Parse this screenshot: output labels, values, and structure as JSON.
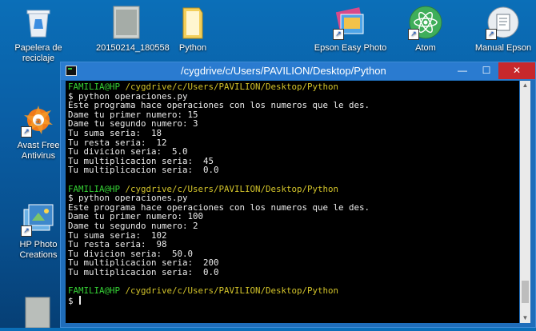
{
  "desktop": {
    "icons": [
      {
        "label": "Papelera de reciclaje",
        "icon": "recycle-bin-icon"
      },
      {
        "label": "20150214_180558",
        "icon": "image-file-icon"
      },
      {
        "label": "Python",
        "icon": "folder-icon"
      },
      {
        "label": "Epson Easy Photo",
        "icon": "photo-app-icon"
      },
      {
        "label": "Atom",
        "icon": "atom-icon"
      },
      {
        "label": "Manual Epson",
        "icon": "manual-icon"
      },
      {
        "label": "Avast Free Antivirus",
        "icon": "avast-icon"
      },
      {
        "label": "HP Photo Creations",
        "icon": "hp-photo-icon"
      }
    ]
  },
  "terminal": {
    "title": "/cygdrive/c/Users/PAVILION/Desktop/Python",
    "controls": {
      "minimize": "—",
      "maximize": "☐",
      "close": "✕"
    },
    "prompt_user": "FAMILIA@HP",
    "prompt_path": "/cygdrive/c/Users/PAVILION/Desktop/Python",
    "session1": [
      "$ python operaciones.py",
      "Este programa hace operaciones con los numeros que le des.",
      "Dame tu primer numero: 15",
      "Dame tu segundo numero: 3",
      "Tu suma seria:  18",
      "Tu resta seria:  12",
      "Tu divicion seria:  5.0",
      "Tu multiplicacion seria:  45",
      "Tu multiplicacion seria:  0.0"
    ],
    "session2": [
      "$ python operaciones.py",
      "Este programa hace operaciones con los numeros que le des.",
      "Dame tu primer numero: 100",
      "Dame tu segundo numero: 2",
      "Tu suma seria:  102",
      "Tu resta seria:  98",
      "Tu divicion seria:  50.0",
      "Tu multiplicacion seria:  200",
      "Tu multiplicacion seria:  0.0"
    ],
    "final_prompt": "$ "
  },
  "colors": {
    "prompt_user": "#35d135",
    "prompt_path": "#d2c32a",
    "titlebar": "#2a7bd0",
    "close": "#c7282c"
  }
}
